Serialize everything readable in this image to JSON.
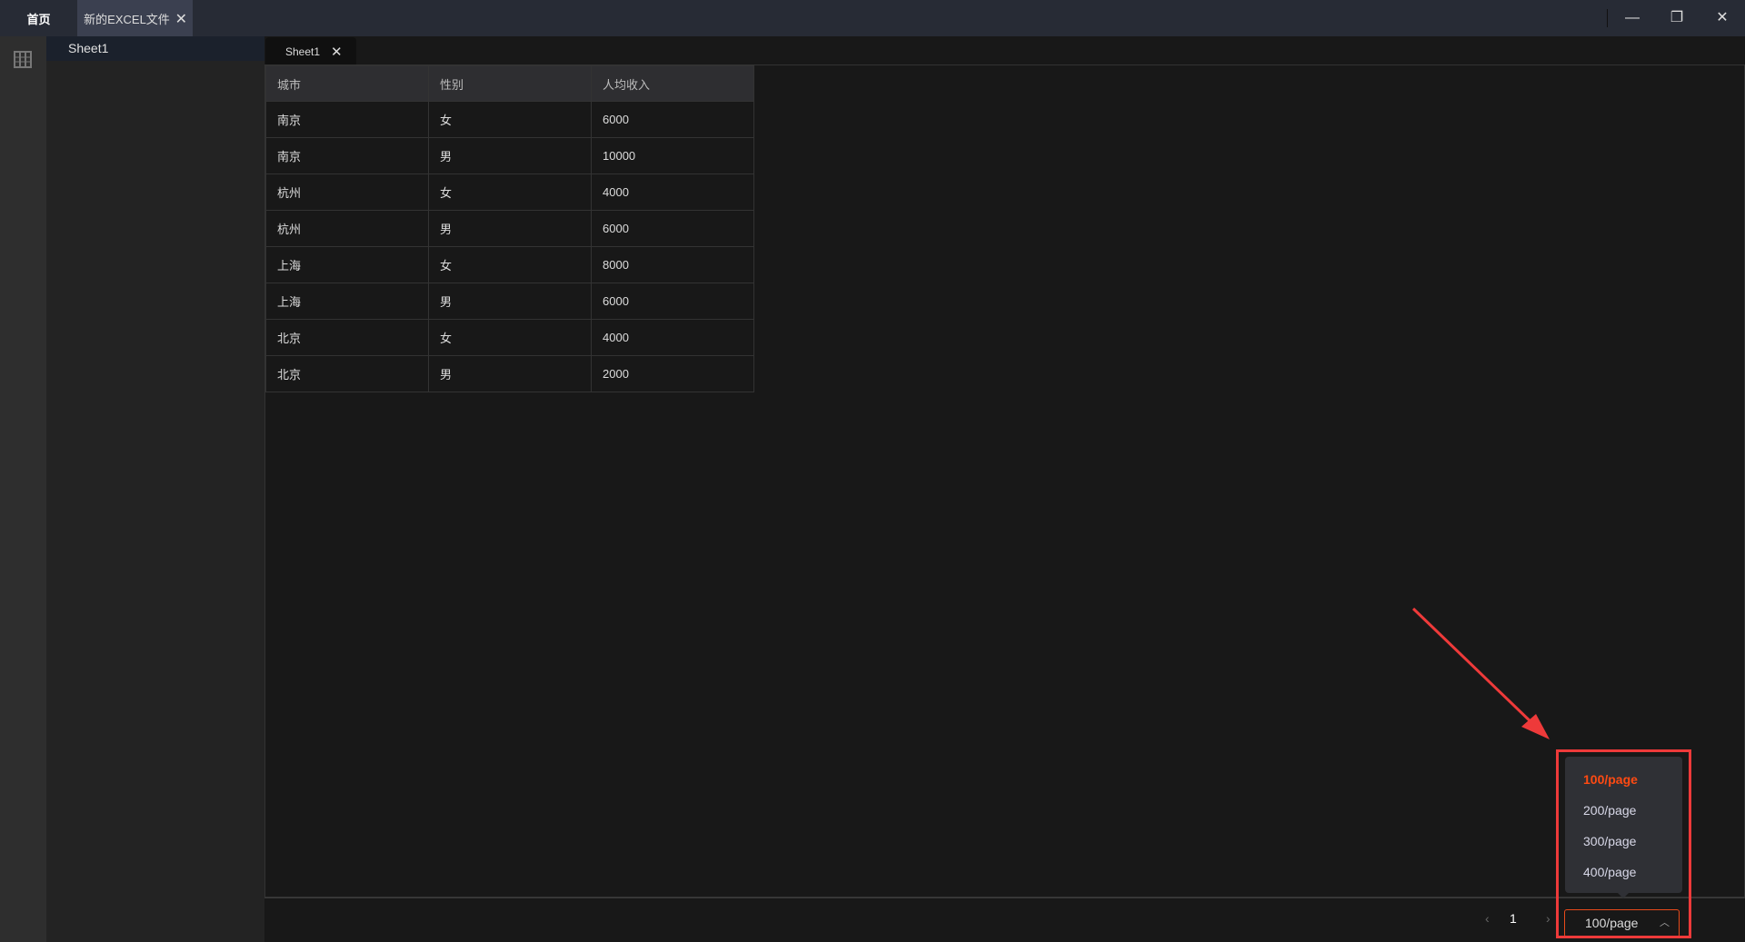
{
  "titlebar": {
    "tabs": [
      {
        "label": "首页"
      },
      {
        "label": "新的EXCEL文件"
      }
    ]
  },
  "sidebar": {
    "sheets": [
      "Sheet1"
    ]
  },
  "sheet_tab": {
    "label": "Sheet1"
  },
  "table": {
    "headers": [
      "城市",
      "性别",
      "人均收入"
    ],
    "rows": [
      [
        "南京",
        "女",
        "6000"
      ],
      [
        "南京",
        "男",
        "10000"
      ],
      [
        "杭州",
        "女",
        "4000"
      ],
      [
        "杭州",
        "男",
        "6000"
      ],
      [
        "上海",
        "女",
        "8000"
      ],
      [
        "上海",
        "男",
        "6000"
      ],
      [
        "北京",
        "女",
        "4000"
      ],
      [
        "北京",
        "男",
        "2000"
      ]
    ]
  },
  "pager": {
    "current_page": "1",
    "page_size": "100/page",
    "options": [
      "100/page",
      "200/page",
      "300/page",
      "400/page"
    ],
    "selected_index": 0
  },
  "colors": {
    "accent": "#ff4a12",
    "annotation": "#ee3a3a"
  }
}
